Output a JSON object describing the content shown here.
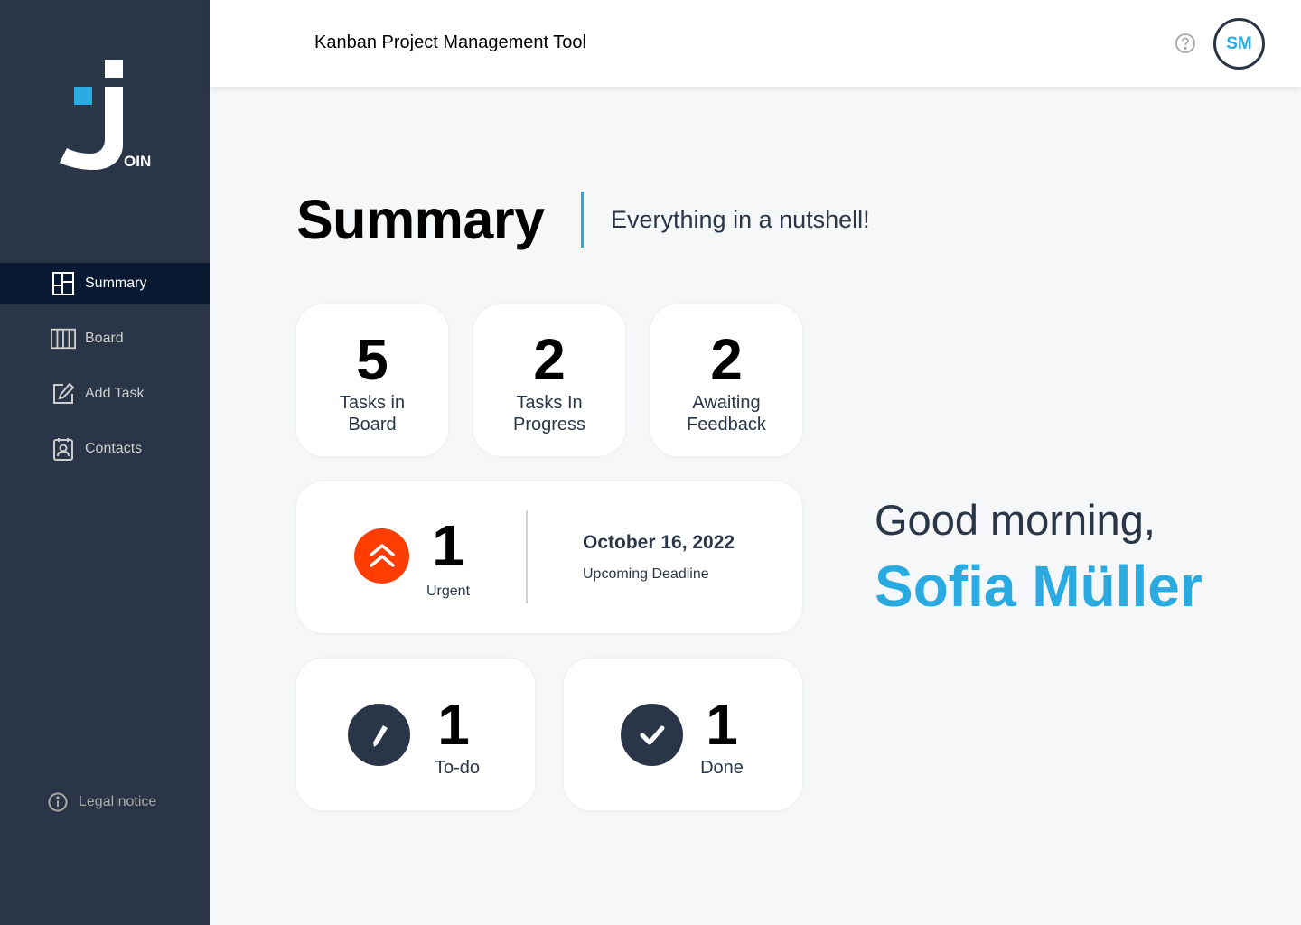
{
  "app": {
    "title": "Kanban Project Management Tool",
    "logo_text": "OIN",
    "avatar_initials": "SM"
  },
  "colors": {
    "sidebar": "#2a3647",
    "sidebar_active": "#091931",
    "accent": "#29abe2",
    "urgent": "#ff3d00"
  },
  "sidebar": {
    "items": [
      {
        "label": "Summary",
        "icon": "summary-icon",
        "active": true
      },
      {
        "label": "Board",
        "icon": "board-icon",
        "active": false
      },
      {
        "label": "Add Task",
        "icon": "add-task-icon",
        "active": false
      },
      {
        "label": "Contacts",
        "icon": "contacts-icon",
        "active": false
      }
    ],
    "legal_label": "Legal notice"
  },
  "summary": {
    "title": "Summary",
    "subtitle": "Everything in a nutshell!",
    "stats": [
      {
        "value": "5",
        "label": "Tasks in Board"
      },
      {
        "value": "2",
        "label": "Tasks In Progress"
      },
      {
        "value": "2",
        "label": "Awaiting Feedback"
      }
    ],
    "urgent": {
      "value": "1",
      "label": "Urgent"
    },
    "deadline": {
      "date": "October 16, 2022",
      "label": "Upcoming Deadline"
    },
    "todo": {
      "value": "1",
      "label": "To-do"
    },
    "done": {
      "value": "1",
      "label": "Done"
    }
  },
  "greeting": {
    "text": "Good morning,",
    "name": "Sofia Müller"
  }
}
